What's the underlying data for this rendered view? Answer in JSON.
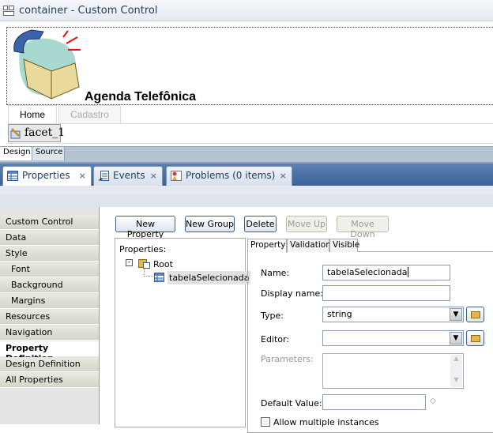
{
  "window": {
    "title": "container - Custom Control"
  },
  "editor": {
    "heading": "Agenda Telefônica",
    "tabs": [
      "Home",
      "Cadastro"
    ],
    "facet": "facet_1",
    "mode_tabs": [
      "Design",
      "Source"
    ]
  },
  "views": {
    "tabs": [
      {
        "label": "Properties",
        "icon": "properties-icon"
      },
      {
        "label": "Events",
        "icon": "events-icon"
      },
      {
        "label": "Problems (0 items)",
        "icon": "problems-icon"
      }
    ],
    "close": "×"
  },
  "nav": {
    "items": [
      "Custom Control",
      "Data",
      "Style",
      "Font",
      "Background",
      "Margins",
      "Resources",
      "Navigation",
      "Property Definition",
      "Design Definition",
      "All Properties"
    ],
    "active": "Property Definition"
  },
  "toolbar": {
    "new_property": "New Property",
    "new_group": "New Group",
    "delete": "Delete",
    "move_up": "Move Up",
    "move_down": "Move Down"
  },
  "tree": {
    "label": "Properties:",
    "root": "Root",
    "child": "tabelaSelecionada"
  },
  "detail": {
    "tabs": [
      "Property",
      "Validation",
      "Visible"
    ],
    "name_label": "Name:",
    "name_value": "tabelaSelecionada",
    "display_label": "Display name:",
    "display_value": "",
    "type_label": "Type:",
    "type_value": "string",
    "editor_label": "Editor:",
    "editor_value": "",
    "params_label": "Parameters:",
    "default_label": "Default Value:",
    "default_value": "",
    "allow_multiple": "Allow multiple instances",
    "allow_multiple_checked": false
  },
  "colors": {
    "view_bar": "#3a6296",
    "accent_text": "#1f3a5f"
  }
}
